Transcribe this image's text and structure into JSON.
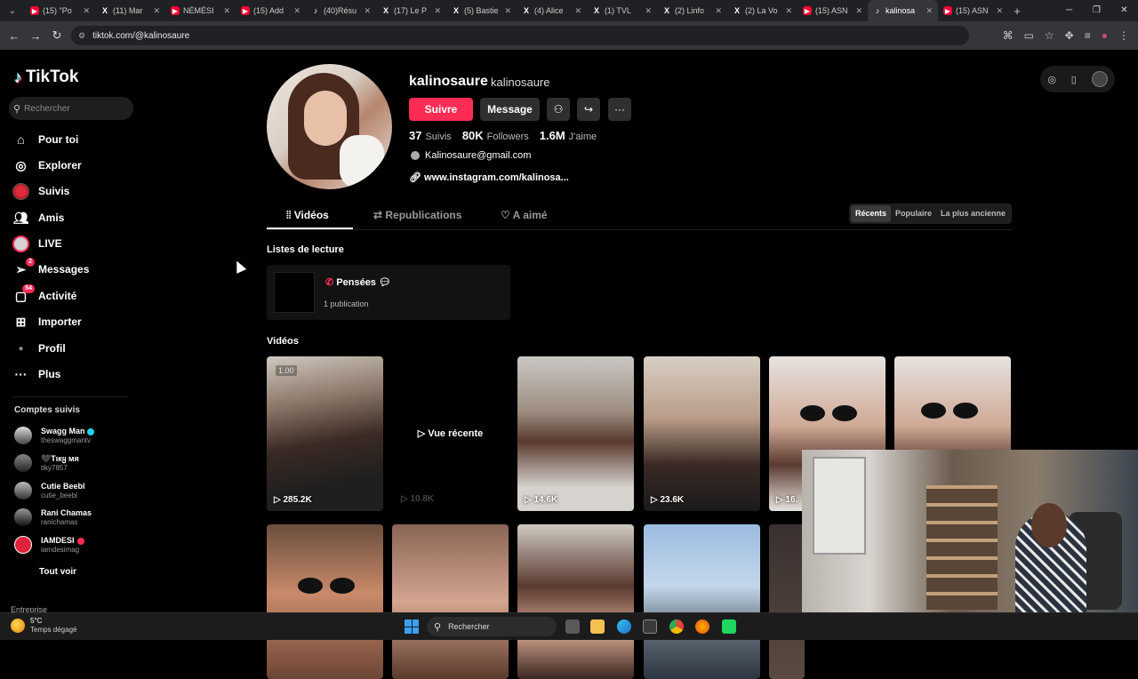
{
  "browser": {
    "tabs": [
      {
        "icon": "youtube",
        "label": "(15) \"Po"
      },
      {
        "icon": "x",
        "label": "(11) Mar"
      },
      {
        "icon": "youtube",
        "label": "NÉMÉSI"
      },
      {
        "icon": "youtube",
        "label": "(15) Add"
      },
      {
        "icon": "tiktok",
        "label": "(40)Résu"
      },
      {
        "icon": "x",
        "label": "(17) Le P"
      },
      {
        "icon": "x",
        "label": "(5) Bastie"
      },
      {
        "icon": "x",
        "label": "(4) Alice"
      },
      {
        "icon": "x",
        "label": "(1) TVL"
      },
      {
        "icon": "x",
        "label": "(2) Linfo"
      },
      {
        "icon": "x",
        "label": "(2) La Vo"
      },
      {
        "icon": "youtube",
        "label": "(15) ASN"
      },
      {
        "icon": "tiktok",
        "label": "kalinosa",
        "active": true
      },
      {
        "icon": "youtube",
        "label": "(15) ASN"
      }
    ],
    "url": "tiktok.com/@kalinosaure"
  },
  "sidebar": {
    "logo": "TikTok",
    "search_placeholder": "Rechercher",
    "items": [
      {
        "label": "Pour toi",
        "icon": "home-icon"
      },
      {
        "label": "Explorer",
        "icon": "compass-icon"
      },
      {
        "label": "Suivis",
        "icon": "following-avatar-icon"
      },
      {
        "label": "Amis",
        "icon": "friends-icon"
      },
      {
        "label": "LIVE",
        "icon": "live-avatar-icon"
      },
      {
        "label": "Messages",
        "icon": "send-icon",
        "badge": "2"
      },
      {
        "label": "Activité",
        "icon": "inbox-icon",
        "badge": "54"
      },
      {
        "label": "Importer",
        "icon": "upload-icon"
      },
      {
        "label": "Profil",
        "icon": "profile-icon"
      },
      {
        "label": "Plus",
        "icon": "more-icon"
      }
    ],
    "followed_title": "Comptes suivis",
    "followed": [
      {
        "name": "Swagg Man",
        "handle": "theswaggmantv",
        "verified": true
      },
      {
        "name": "🖤Tιкყ мя",
        "handle": "tiky7857"
      },
      {
        "name": "Cutie Beebl",
        "handle": "cutie_beebl"
      },
      {
        "name": "Rani Chamas",
        "handle": "ranichamas"
      },
      {
        "name": "IAMDESI",
        "handle": "iamdesimag"
      }
    ],
    "see_all": "Tout voir",
    "footer": "Entreprise"
  },
  "profile": {
    "username": "kalinosaure",
    "nickname": "kalinosaure",
    "follow_label": "Suivre",
    "message_label": "Message",
    "stats": [
      {
        "value": "37",
        "label": "Suivis"
      },
      {
        "value": "80K",
        "label": "Followers"
      },
      {
        "value": "1.6M",
        "label": "J'aime"
      }
    ],
    "email": "Kalinosaure@gmail.com",
    "link": "www.instagram.com/kalinosa..."
  },
  "tabs": {
    "videos": "Vidéos",
    "reposts": "Republications",
    "liked": "A aimé"
  },
  "sort": {
    "recent": "Récents",
    "popular": "Populaire",
    "oldest": "La plus ancienne"
  },
  "playlists": {
    "title": "Listes de lecture",
    "items": [
      {
        "name": "Pensées",
        "count": "1 publication"
      }
    ]
  },
  "videos": {
    "title": "Vidéos",
    "recent_label": "Vue récente",
    "row1": [
      {
        "views": "285.2K",
        "tag": "1.00"
      },
      {
        "views": "10.8K"
      },
      {
        "views": "14.6K"
      },
      {
        "views": "23.6K"
      },
      {
        "views": "16."
      },
      {
        "views": ""
      }
    ]
  },
  "taskbar": {
    "temp": "5°C",
    "weather": "Temps dégagé",
    "search": "Rechercher"
  },
  "colors": {
    "accent": "#fe2c55",
    "background": "#000000"
  }
}
